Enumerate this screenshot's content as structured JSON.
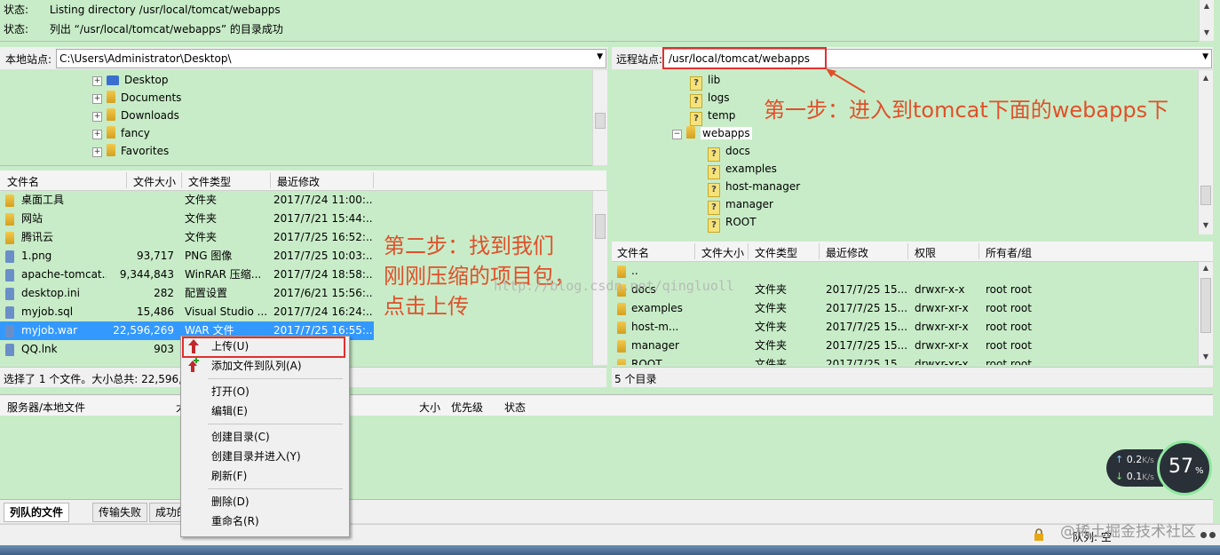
{
  "status": {
    "lines": [
      {
        "label": "状态:",
        "text": "Listing directory /usr/local/tomcat/webapps"
      },
      {
        "label": "状态:",
        "text": "列出 “/usr/local/tomcat/webapps” 的目录成功"
      }
    ]
  },
  "local": {
    "site_label": "本地站点:",
    "path": "C:\\Users\\Administrator\\Desktop\\",
    "tree": [
      {
        "name": "Desktop",
        "icon": "desktop-icon"
      },
      {
        "name": "Documents",
        "icon": "documents-icon"
      },
      {
        "name": "Downloads",
        "icon": "downloads-icon"
      },
      {
        "name": "fancy",
        "icon": "folder-icon"
      },
      {
        "name": "Favorites",
        "icon": "favorites-icon"
      }
    ],
    "columns": [
      "文件名",
      "文件大小",
      "文件类型",
      "最近修改"
    ],
    "files": [
      {
        "name": "桌面工具",
        "size": "",
        "type": "文件夹",
        "modified": "2017/7/24 11:00:...",
        "icon": "folder-icon"
      },
      {
        "name": "网站",
        "size": "",
        "type": "文件夹",
        "modified": "2017/7/21 15:44:...",
        "icon": "folder-icon"
      },
      {
        "name": "腾讯云",
        "size": "",
        "type": "文件夹",
        "modified": "2017/7/25 16:52:...",
        "icon": "folder-icon"
      },
      {
        "name": "1.png",
        "size": "93,717",
        "type": "PNG 图像",
        "modified": "2017/7/25 10:03:...",
        "icon": "png-file-icon"
      },
      {
        "name": "apache-tomcat...",
        "size": "9,344,843",
        "type": "WinRAR 压缩...",
        "modified": "2017/7/24 18:58:...",
        "icon": "archive-file-icon"
      },
      {
        "name": "desktop.ini",
        "size": "282",
        "type": "配置设置",
        "modified": "2017/6/21 15:56:...",
        "icon": "ini-file-icon"
      },
      {
        "name": "myjob.sql",
        "size": "15,486",
        "type": "Visual Studio ...",
        "modified": "2017/7/24 16:24:...",
        "icon": "sql-file-icon"
      },
      {
        "name": "myjob.war",
        "size": "22,596,269",
        "type": "WAR 文件",
        "modified": "2017/7/25 16:55:...",
        "icon": "war-file-icon",
        "selected": true
      },
      {
        "name": "QQ.lnk",
        "size": "903",
        "type": "",
        "modified": "2017/7/...:9...",
        "icon": "qq-icon"
      }
    ],
    "status": "选择了 1 个文件。大小总共: 22,596,2..."
  },
  "remote": {
    "site_label": "远程站点:",
    "path": "/usr/local/tomcat/webapps",
    "tree": [
      {
        "name": "lib",
        "level": 0
      },
      {
        "name": "logs",
        "level": 0
      },
      {
        "name": "temp",
        "level": 0
      },
      {
        "name": "webapps",
        "level": 0,
        "open": true,
        "highlight": true
      },
      {
        "name": "docs",
        "level": 1
      },
      {
        "name": "examples",
        "level": 1
      },
      {
        "name": "host-manager",
        "level": 1
      },
      {
        "name": "manager",
        "level": 1
      },
      {
        "name": "ROOT",
        "level": 1
      }
    ],
    "columns": [
      "文件名",
      "文件大小",
      "文件类型",
      "最近修改",
      "权限",
      "所有者/组"
    ],
    "files": [
      {
        "name": "..",
        "type": "",
        "modified": "",
        "perm": "",
        "owner": ""
      },
      {
        "name": "docs",
        "type": "文件夹",
        "modified": "2017/7/25 15...",
        "perm": "drwxr-x-x",
        "owner": "root root"
      },
      {
        "name": "examples",
        "type": "文件夹",
        "modified": "2017/7/25 15...",
        "perm": "drwxr-xr-x",
        "owner": "root root"
      },
      {
        "name": "host-m...",
        "type": "文件夹",
        "modified": "2017/7/25 15...",
        "perm": "drwxr-xr-x",
        "owner": "root root"
      },
      {
        "name": "manager",
        "type": "文件夹",
        "modified": "2017/7/25 15...",
        "perm": "drwxr-xr-x",
        "owner": "root root"
      },
      {
        "name": "ROOT",
        "type": "文件夹",
        "modified": "2017/7/25 15...",
        "perm": "drwxr-xr-x",
        "owner": "root root"
      }
    ],
    "status": "5 个目录"
  },
  "queue": {
    "columns": [
      "服务器/本地文件",
      "大",
      "大小",
      "优先级",
      "状态"
    ],
    "tabs": [
      "列队的文件",
      "传输失败",
      "成功的"
    ],
    "queue_status": "队列: 空"
  },
  "context_menu": {
    "items": [
      {
        "label": "上传(U)",
        "highlight": true,
        "icon": "upload-arrow-icon"
      },
      {
        "label": "添加文件到队列(A)",
        "icon": "add-to-queue-icon"
      },
      {
        "separator": true
      },
      {
        "label": "打开(O)"
      },
      {
        "label": "编辑(E)"
      },
      {
        "separator": true
      },
      {
        "label": "创建目录(C)"
      },
      {
        "label": "创建目录并进入(Y)"
      },
      {
        "label": "刷新(F)"
      },
      {
        "separator": true
      },
      {
        "label": "删除(D)"
      },
      {
        "label": "重命名(R)"
      }
    ]
  },
  "annotations": {
    "step1": "第一步：进入到tomcat下面的webapps下",
    "step2_lines": [
      "第二步：找到我们",
      "刚刚压缩的项目包，",
      "点击上传"
    ],
    "watermark": "http://blog.csdn.net/qingluoll",
    "corner_watermark": "@稀土掘金技术社区"
  },
  "speed_widget": {
    "up": "0.2",
    "down": "0.1",
    "unit": "K/s",
    "percent": "57",
    "percent_sign": "%"
  },
  "colors": {
    "panel_green": "#c8ecc8",
    "annotation": "#e0502a",
    "highlight_box": "#e03030",
    "selection": "#3399ff"
  }
}
